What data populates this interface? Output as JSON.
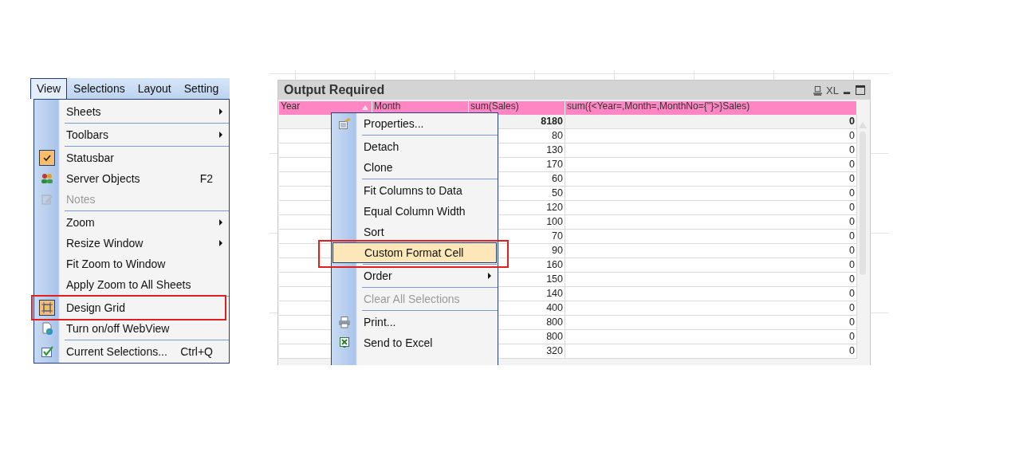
{
  "menu_bar": {
    "items": [
      {
        "label": "View",
        "selected": true
      },
      {
        "label": "Selections",
        "selected": false
      },
      {
        "label": "Layout",
        "selected": false
      },
      {
        "label": "Setting",
        "selected": false
      }
    ]
  },
  "view_menu": {
    "items": [
      {
        "label": "Sheets",
        "submenu": true,
        "checked": false,
        "disabled": false,
        "annotated": false,
        "separator_after": true
      },
      {
        "label": "Toolbars",
        "submenu": true,
        "checked": false,
        "disabled": false,
        "annotated": false,
        "separator_after": true
      },
      {
        "label": "Statusbar",
        "submenu": false,
        "checked": true,
        "disabled": false,
        "annotated": false,
        "separator_after": false
      },
      {
        "label": "Server Objects",
        "shortcut": "F2",
        "submenu": false,
        "checked": false,
        "disabled": false,
        "annotated": false,
        "separator_after": false
      },
      {
        "label": "Notes",
        "submenu": false,
        "checked": false,
        "disabled": true,
        "annotated": false,
        "separator_after": true
      },
      {
        "label": "Zoom",
        "submenu": true,
        "checked": false,
        "disabled": false,
        "annotated": false,
        "separator_after": false
      },
      {
        "label": "Resize Window",
        "submenu": true,
        "checked": false,
        "disabled": false,
        "annotated": false,
        "separator_after": false
      },
      {
        "label": "Fit Zoom to Window",
        "submenu": false,
        "checked": false,
        "disabled": false,
        "annotated": false,
        "separator_after": false
      },
      {
        "label": "Apply Zoom to All Sheets",
        "submenu": false,
        "checked": false,
        "disabled": false,
        "annotated": false,
        "separator_after": true
      },
      {
        "label": "Design Grid",
        "submenu": false,
        "checked": true,
        "disabled": false,
        "annotated": true,
        "separator_after": false
      },
      {
        "label": "Turn on/off WebView",
        "submenu": false,
        "checked": false,
        "disabled": false,
        "annotated": false,
        "separator_after": true
      },
      {
        "label": "Current Selections...",
        "shortcut": "Ctrl+Q",
        "submenu": false,
        "checked": false,
        "disabled": false,
        "annotated": false,
        "separator_after": false
      }
    ]
  },
  "table_window": {
    "title": "Output Required",
    "xl_label": "XL",
    "columns": [
      {
        "label": "Year",
        "sorted": true
      },
      {
        "label": "Month",
        "sorted": false
      },
      {
        "label": "sum(Sales)",
        "sorted": false
      },
      {
        "label": "sum({<Year=,Month=,MonthNo={''}>}Sales)",
        "sorted": false
      }
    ],
    "rows": [
      {
        "kind": "total",
        "sales": "8180",
        "expr": "0"
      },
      {
        "kind": "data",
        "sales": "80",
        "expr": "0"
      },
      {
        "kind": "data",
        "sales": "130",
        "expr": "0"
      },
      {
        "kind": "data",
        "sales": "170",
        "expr": "0"
      },
      {
        "kind": "data",
        "sales": "60",
        "expr": "0"
      },
      {
        "kind": "data",
        "sales": "50",
        "expr": "0"
      },
      {
        "kind": "data",
        "sales": "120",
        "expr": "0"
      },
      {
        "kind": "data",
        "sales": "100",
        "expr": "0"
      },
      {
        "kind": "data",
        "sales": "70",
        "expr": "0"
      },
      {
        "kind": "data",
        "sales": "90",
        "expr": "0"
      },
      {
        "kind": "data",
        "sales": "160",
        "expr": "0"
      },
      {
        "kind": "data",
        "sales": "150",
        "expr": "0"
      },
      {
        "kind": "data",
        "sales": "140",
        "expr": "0"
      },
      {
        "kind": "data",
        "sales": "400",
        "expr": "0"
      },
      {
        "kind": "data",
        "sales": "800",
        "expr": "0"
      },
      {
        "kind": "data",
        "sales": "800",
        "expr": "0"
      },
      {
        "kind": "data",
        "sales": "320",
        "expr": "0"
      }
    ]
  },
  "context_menu": {
    "items": [
      {
        "label": "Properties...",
        "submenu": false,
        "selected": false,
        "disabled": false,
        "annotated": false,
        "separator_after": true
      },
      {
        "label": "Detach",
        "submenu": false,
        "selected": false,
        "disabled": false,
        "annotated": false,
        "separator_after": false
      },
      {
        "label": "Clone",
        "submenu": false,
        "selected": false,
        "disabled": false,
        "annotated": false,
        "separator_after": true
      },
      {
        "label": "Fit Columns to Data",
        "submenu": false,
        "selected": false,
        "disabled": false,
        "annotated": false,
        "separator_after": false
      },
      {
        "label": "Equal Column Width",
        "submenu": false,
        "selected": false,
        "disabled": false,
        "annotated": false,
        "separator_after": false
      },
      {
        "label": "Sort",
        "submenu": false,
        "selected": false,
        "disabled": false,
        "annotated": false,
        "separator_after": false
      },
      {
        "label": "Custom Format Cell",
        "submenu": false,
        "selected": true,
        "disabled": false,
        "annotated": true,
        "separator_after": true
      },
      {
        "label": "Order",
        "submenu": true,
        "selected": false,
        "disabled": false,
        "annotated": false,
        "separator_after": true
      },
      {
        "label": "Clear All Selections",
        "submenu": false,
        "selected": false,
        "disabled": true,
        "annotated": false,
        "separator_after": true
      },
      {
        "label": "Print...",
        "submenu": false,
        "selected": false,
        "disabled": false,
        "annotated": false,
        "separator_after": false
      },
      {
        "label": "Send to Excel",
        "submenu": false,
        "selected": false,
        "disabled": false,
        "annotated": false,
        "separator_after": false
      }
    ]
  }
}
